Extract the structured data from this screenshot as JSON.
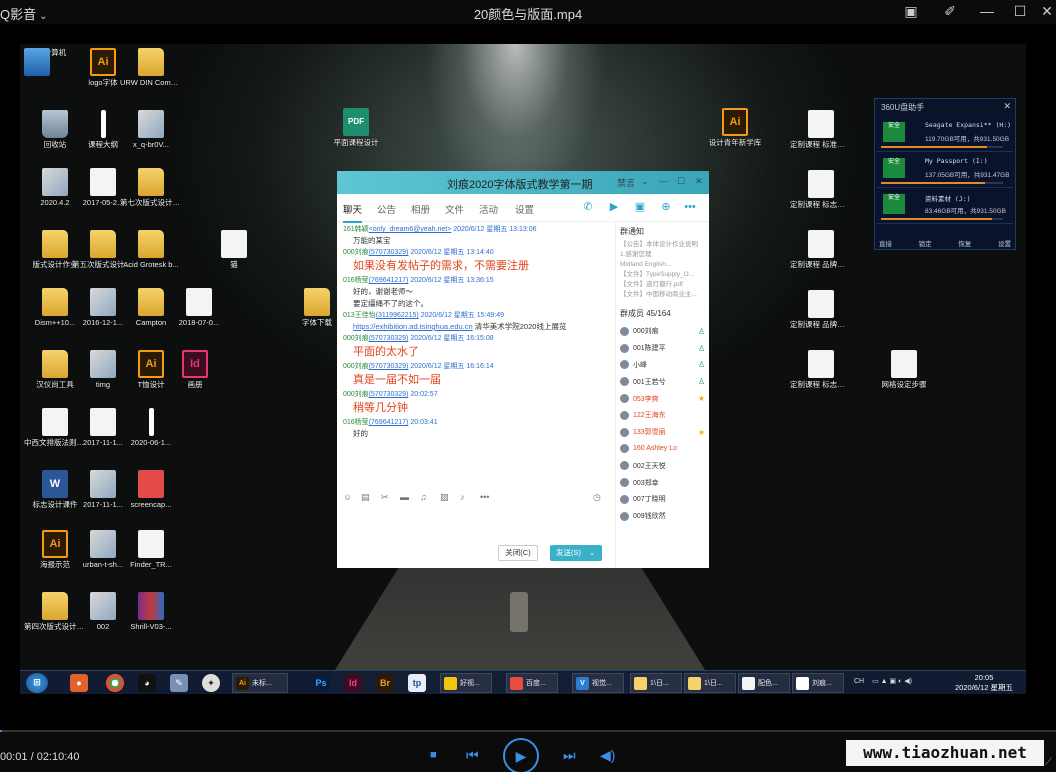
{
  "player": {
    "app_name": "Q影音",
    "file_title": "20颜色与版面.mp4",
    "time": "00:01 / 02:10:40",
    "progress_fraction": 0.0001,
    "watermark": "www.tiaozhuan.net",
    "accent": "#3a8ee6"
  },
  "desktop_icons": [
    {
      "label": "计算机",
      "kind": "pc"
    },
    {
      "label": "logo字体",
      "kind": "ai"
    },
    {
      "label": "URW DIN Complete",
      "kind": "folder"
    },
    {
      "label": "回收站",
      "kind": "bin"
    },
    {
      "label": "课程大纲",
      "kind": "white"
    },
    {
      "label": "x_q-br0V...",
      "kind": "thumb"
    },
    {
      "label": "2020.4.2",
      "kind": "thumb"
    },
    {
      "label": "2017-05-2...",
      "kind": "doc"
    },
    {
      "label": "第七次版式设计作业",
      "kind": "folder"
    },
    {
      "label": "版式设计作业",
      "kind": "folder"
    },
    {
      "label": "第五次版式设计作业",
      "kind": "folder"
    },
    {
      "label": "Acid Grotesk b...",
      "kind": "folder"
    },
    {
      "label": "Dism++10...",
      "kind": "folder"
    },
    {
      "label": "2016-12-1...",
      "kind": "thumb"
    },
    {
      "label": "Campton",
      "kind": "folder"
    },
    {
      "label": "2018-07-0...",
      "kind": "doc"
    },
    {
      "label": "汉仪尚工具",
      "kind": "folder"
    },
    {
      "label": "timg",
      "kind": "thumb"
    },
    {
      "label": "T恤设计",
      "kind": "ai"
    },
    {
      "label": "画册",
      "kind": "id"
    },
    {
      "label": "中西文排版法则相关问题",
      "kind": "doc"
    },
    {
      "label": "2017-11-1...",
      "kind": "doc"
    },
    {
      "label": "2020-06-1...",
      "kind": "white"
    },
    {
      "label": "标志设计课件",
      "kind": "word"
    },
    {
      "label": "2017-11-1...",
      "kind": "thumb"
    },
    {
      "label": "screencap...",
      "kind": "red"
    },
    {
      "label": "海报示范",
      "kind": "ai"
    },
    {
      "label": "urban-t-sh...",
      "kind": "thumb"
    },
    {
      "label": "Finder_TR...",
      "kind": "doc"
    },
    {
      "label": "第四次版式设计作业",
      "kind": "folder"
    },
    {
      "label": "002",
      "kind": "thumb"
    },
    {
      "label": "Shrill-V03-...",
      "kind": "rar"
    },
    {
      "label": "平面课程设计",
      "kind": "pdf"
    },
    {
      "label": "设计青年新学库",
      "kind": "ai"
    },
    {
      "label": "猫",
      "kind": "doc"
    },
    {
      "label": "字体下载",
      "kind": "folder"
    },
    {
      "label": "定制课程 标准字设计",
      "kind": "doc"
    },
    {
      "label": "定制课程 标志设计表",
      "kind": "doc"
    },
    {
      "label": "定制课程 品牌设计表",
      "kind": "doc"
    },
    {
      "label": "定制课程 品牌形象设计",
      "kind": "doc"
    },
    {
      "label": "定制课程 标志设计",
      "kind": "doc"
    },
    {
      "label": "网格设定步骤",
      "kind": "doc"
    }
  ],
  "widget360": {
    "title": "360U盘助手",
    "drives": [
      {
        "name": "Seagate Expansi** (H:)",
        "info": "119.70GB可用，共931.50GB",
        "used_fraction": 0.87
      },
      {
        "name": "My Passport (I:)",
        "info": "137.05GB可用，共931.47GB",
        "used_fraction": 0.85
      },
      {
        "name": "资料素材 (J:)",
        "info": "83.46GB可用，共931.50GB",
        "used_fraction": 0.91
      }
    ],
    "safe_label": "安全",
    "footer": [
      "直接",
      "锁定",
      "恢复",
      "设置"
    ]
  },
  "qq": {
    "title": "刘痕2020字体版式教学第一期",
    "title_right": "禁言",
    "tabs": [
      "聊天",
      "公告",
      "相册",
      "文件",
      "活动",
      "设置"
    ],
    "messages": [
      {
        "sender": "161韩颖",
        "qq": "<only_dream6@yeah.net>",
        "time": "2020/6/12 星期五 13:13:06",
        "text": "万能的某宝",
        "big": false
      },
      {
        "sender": "000刘痕",
        "qq": "(570730329)",
        "time": "2020/6/12 星期五 13:14:40",
        "text": "如果没有发帖子的需求，不需要注册",
        "big": true
      },
      {
        "sender": "016杨莹",
        "qq": "(769641217)",
        "time": "2020/6/12 星期五 13:36:15",
        "text": "好的，谢谢老师～",
        "text2": "要定缰绳不了的这个。",
        "big": false
      },
      {
        "sender": "013王佳怡",
        "qq": "(3119962215)",
        "time": "2020/6/12 星期五 15:49:49",
        "link": "https://exhibition.ad.tsinghua.edu.cn",
        "text": "清华美术学院2020线上展览",
        "big": false
      },
      {
        "sender": "000刘痕",
        "qq": "(570730329)",
        "time": "2020/6/12 星期五 16:15:08",
        "text": "平面的太水了",
        "big": true
      },
      {
        "sender": "000刘痕",
        "qq": "(570730329)",
        "time": "2020/6/12 星期五 16:16:14",
        "text": "真是一届不如一届",
        "big": true
      },
      {
        "sender": "000刘痕",
        "qq": "(570730329)",
        "time": "20:02:57",
        "text": "稍等几分钟",
        "big": true
      },
      {
        "sender": "016杨莹",
        "qq": "(769641217)",
        "time": "20:03:41",
        "text": "好的",
        "big": false
      }
    ],
    "notice_title": "群通知",
    "notice_lines": [
      "【公告】本体设计作业说明",
      "1.感谢您理",
      "Midland English...",
      "【文件】TypeSupply_O...",
      "【文件】道灯摄行.pdf",
      "【文件】中国移动商业主..."
    ],
    "members_title": "群成员 45/164",
    "members": [
      {
        "name": "000刘痕",
        "style": "normal",
        "mark": "badge"
      },
      {
        "name": "001陈建平",
        "style": "normal",
        "mark": "badge"
      },
      {
        "name": "小峰",
        "style": "normal",
        "mark": "badge"
      },
      {
        "name": "001王若兮",
        "style": "normal",
        "mark": "badge"
      },
      {
        "name": "053李爽",
        "style": "red",
        "mark": "star"
      },
      {
        "name": "122王海东",
        "style": "red",
        "mark": ""
      },
      {
        "name": "133郭雪丽",
        "style": "red",
        "mark": "star"
      },
      {
        "name": "160 Ashley Lo",
        "style": "red",
        "mark": ""
      },
      {
        "name": "002王天悦",
        "style": "normal",
        "mark": ""
      },
      {
        "name": "003郑幸",
        "style": "normal",
        "mark": ""
      },
      {
        "name": "007丁晓明",
        "style": "normal",
        "mark": ""
      },
      {
        "name": "009钱欣然",
        "style": "normal",
        "mark": ""
      }
    ],
    "close_label": "关闭(C)",
    "send_label": "发送(S)",
    "accent": "#3bb0c9"
  },
  "taskbar": {
    "apps": [
      {
        "label": "未标...",
        "mini": "Ai",
        "color": "#f39c12"
      },
      {
        "label": "好视...",
        "mini": "",
        "color": "#f1c40f"
      },
      {
        "label": "百度...",
        "mini": "",
        "color": "#e74c3c"
      },
      {
        "label": "视觉...",
        "mini": "V",
        "color": "#2b7cd3"
      },
      {
        "label": "1\\日...",
        "mini": "",
        "color": "#f6d36a"
      },
      {
        "label": "1\\日...",
        "mini": "",
        "color": "#f6d36a"
      },
      {
        "label": "配色...",
        "mini": "",
        "color": "#f4f4f4"
      },
      {
        "label": "刘痕...",
        "mini": "",
        "color": "#ffffff"
      }
    ],
    "pinned": [
      "Ps",
      "Id",
      "Br",
      "tp"
    ],
    "lang": "CH",
    "clock_time": "20:05",
    "clock_date": "2020/6/12 星期五"
  }
}
